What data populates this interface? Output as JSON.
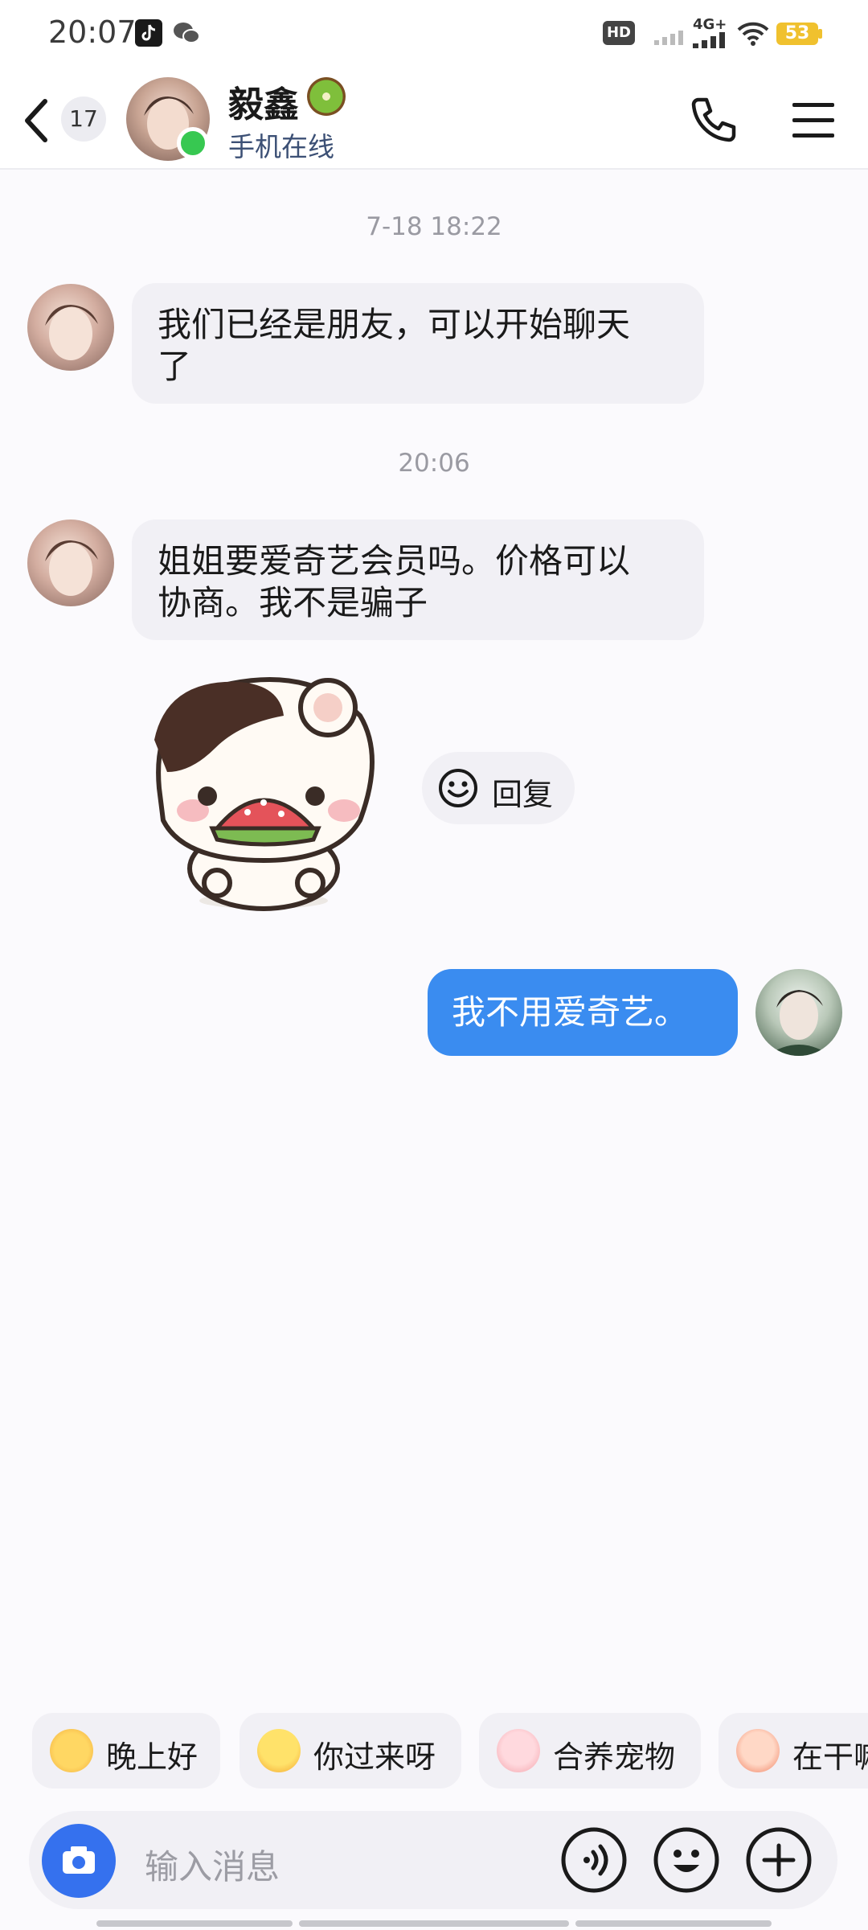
{
  "status_bar": {
    "time": "20:07",
    "battery": "53",
    "network": "4G+",
    "hd_label": "HD"
  },
  "header": {
    "unread_count": "17",
    "contact_name": "毅鑫",
    "name_emoji": "kiwi-emoji",
    "status": "手机在线",
    "online_color": "#37c851"
  },
  "messages": [
    {
      "type": "timestamp",
      "text": "7-18 18:22"
    },
    {
      "type": "incoming",
      "lines": [
        "我们已经是朋友，可以开始聊天",
        "了"
      ]
    },
    {
      "type": "timestamp",
      "text": "20:06"
    },
    {
      "type": "incoming",
      "lines": [
        "姐姐要爱奇艺会员吗。价格可以",
        "协商。我不是骗子"
      ]
    },
    {
      "type": "incoming_sticker",
      "sticker": "cat-eating-watermelon-sticker"
    },
    {
      "type": "outgoing",
      "text": "我不用爱奇艺。"
    }
  ],
  "reply": {
    "label": "回复"
  },
  "quick_replies": [
    {
      "label": "晚上好",
      "icon": "waving-hand-emoji"
    },
    {
      "label": "你过来呀",
      "icon": "crazy-face-emoji"
    },
    {
      "label": "合养宠物",
      "icon": "pet-emoji"
    },
    {
      "label": "在干嘛",
      "icon": "pet-emoji"
    }
  ],
  "input": {
    "placeholder": "输入消息"
  },
  "colors": {
    "accent": "#3a8cf0",
    "camera_button": "#3571ee",
    "bubble_incoming": "#f1f0f5",
    "background": "#fbfafd"
  }
}
